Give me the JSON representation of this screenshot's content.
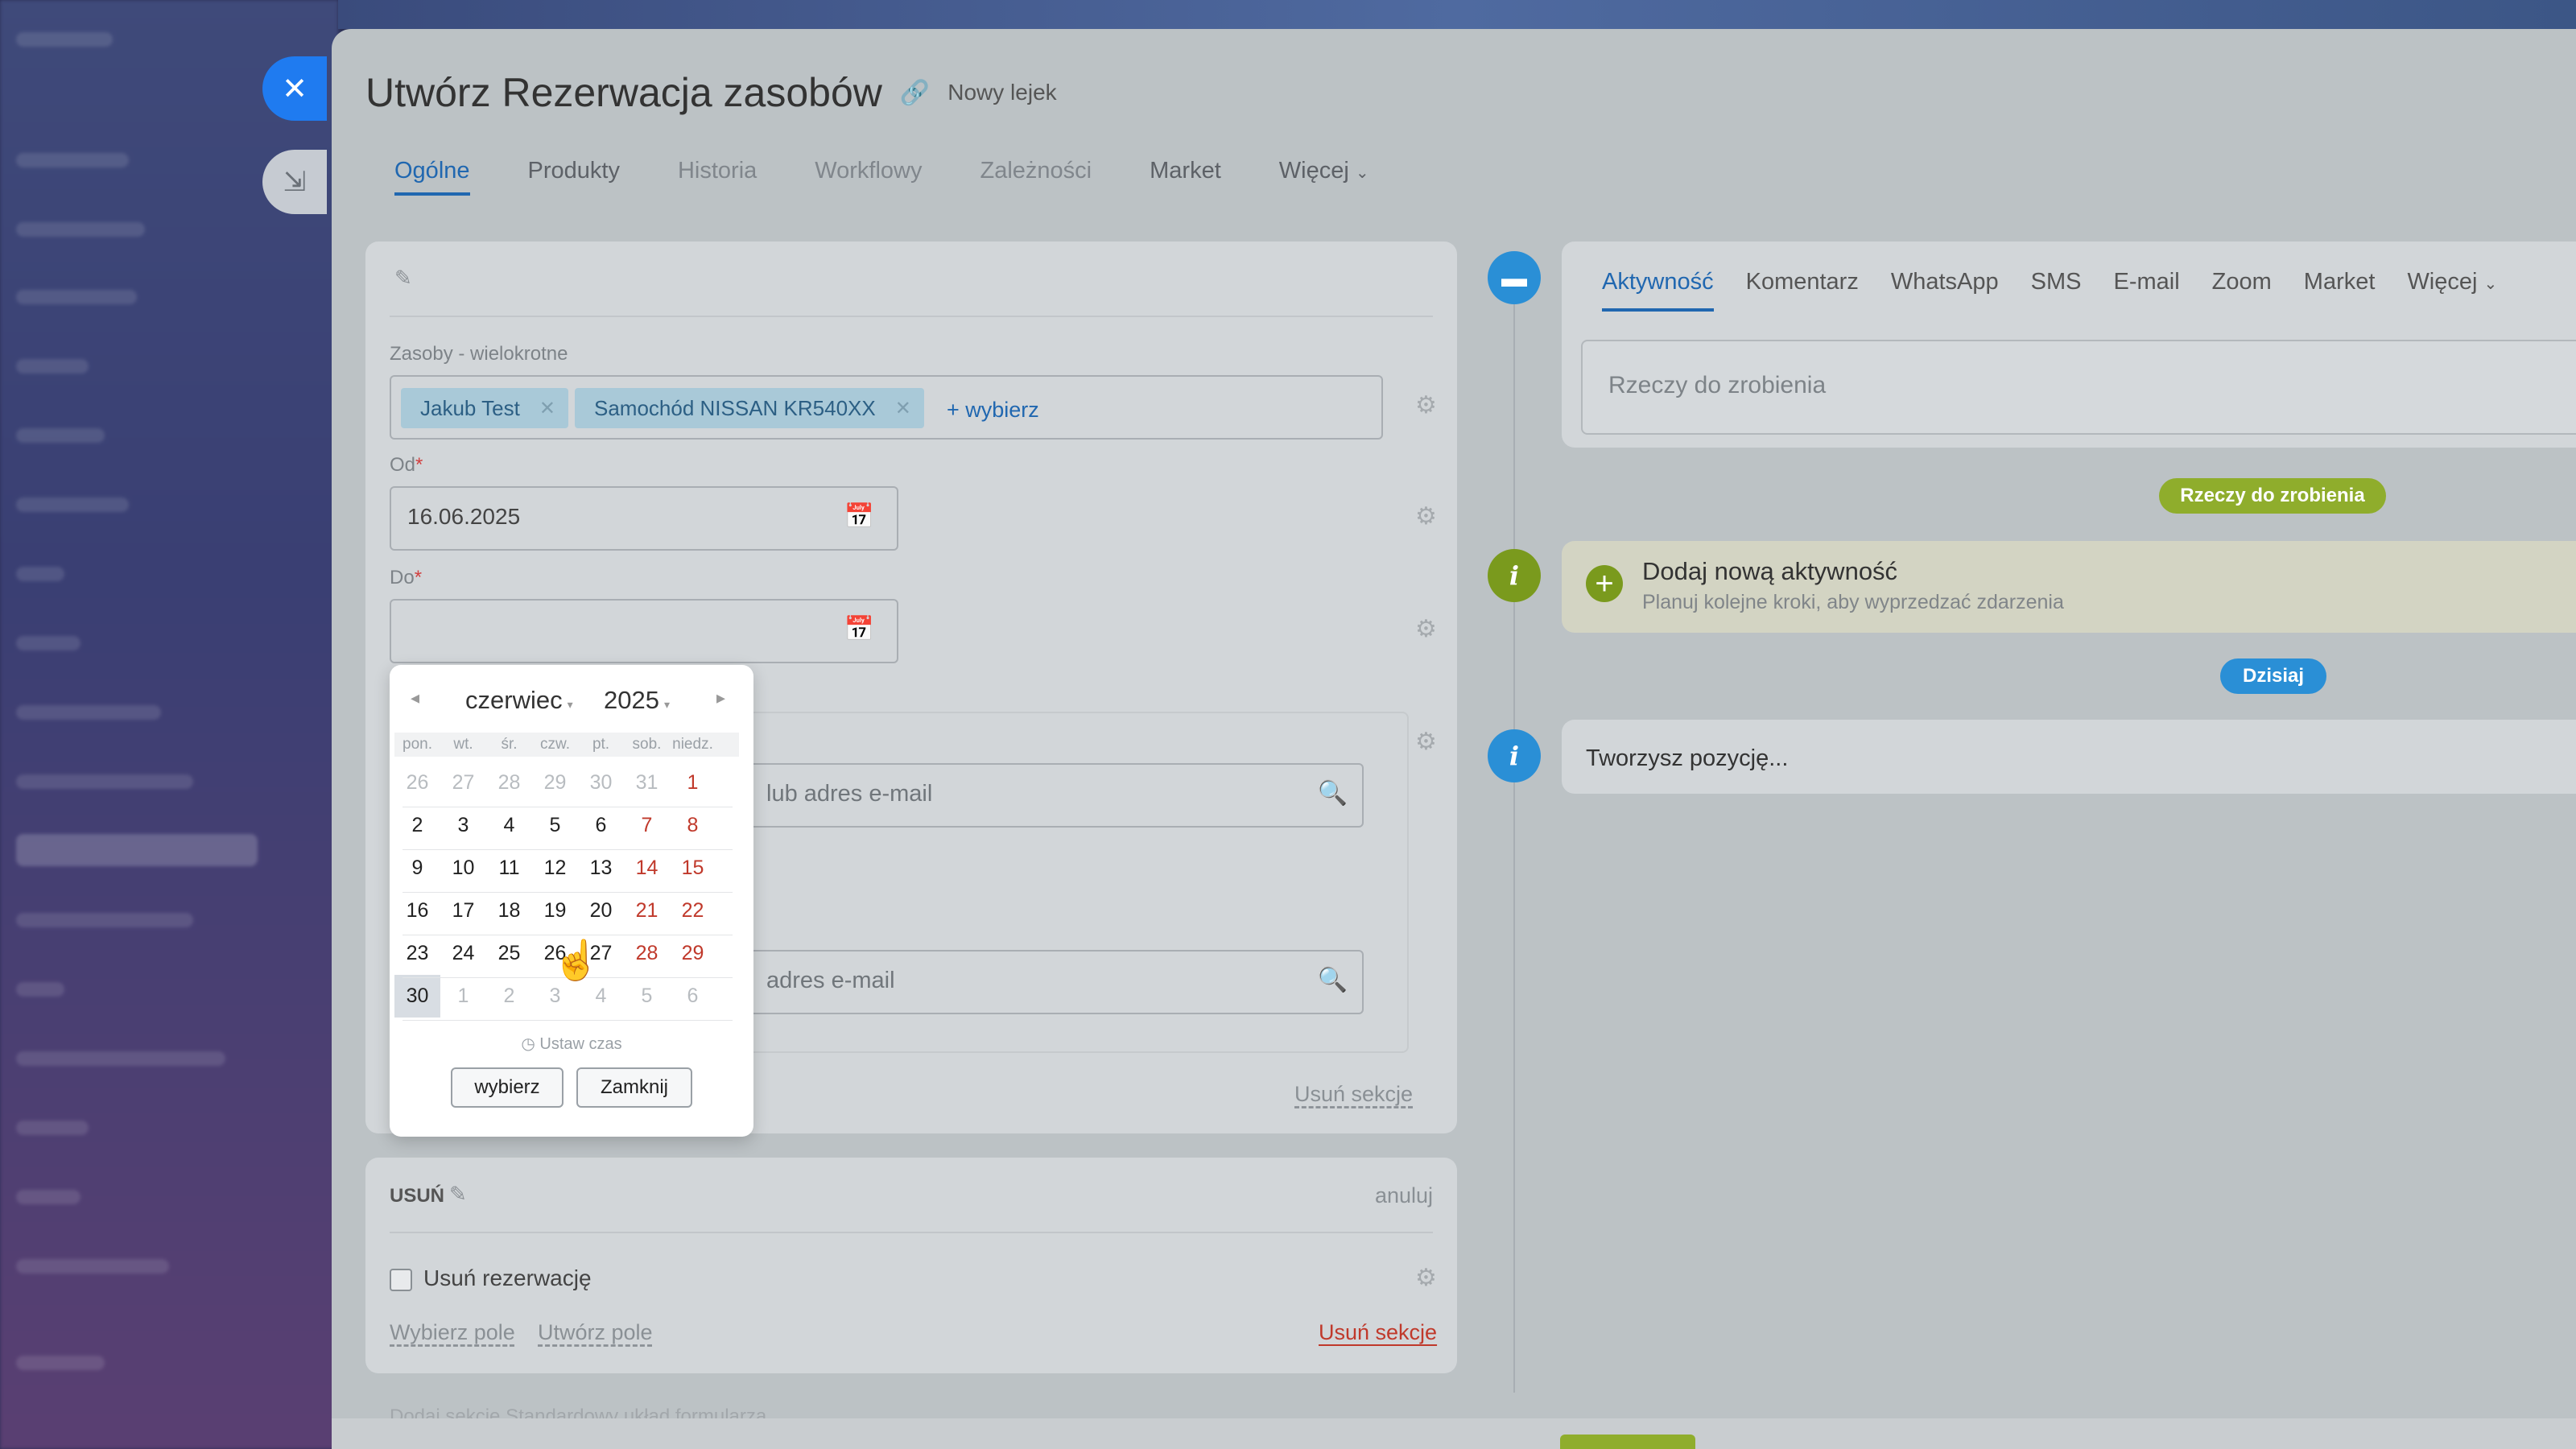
{
  "header": {
    "title": "Utwórz Rezerwacja zasobów",
    "funnel": "Nowy lejek"
  },
  "tabs": [
    "Ogólne",
    "Produkty",
    "Historia",
    "Workflowy",
    "Zależności",
    "Market",
    "Więcej"
  ],
  "form": {
    "resources_label": "Zasoby - wielokrotne",
    "chips": [
      "Jakub Test",
      "Samochód NISSAN KR540XX"
    ],
    "add_link": "+ wybierz",
    "from_label": "Od",
    "from_value": "16.06.2025",
    "to_label": "Do",
    "required_mark": "*",
    "search1_placeholder": "lub adres e-mail",
    "search2_placeholder": "adres e-mail",
    "remove_section": "Usuń sekcje"
  },
  "calendar": {
    "month": "czerwiec",
    "year": "2025",
    "weekdays": [
      "pon.",
      "wt.",
      "śr.",
      "czw.",
      "pt.",
      "sob.",
      "niedz."
    ],
    "weeks": [
      [
        "26",
        "27",
        "28",
        "29",
        "30",
        "31",
        "1"
      ],
      [
        "2",
        "3",
        "4",
        "5",
        "6",
        "7",
        "8"
      ],
      [
        "9",
        "10",
        "11",
        "12",
        "13",
        "14",
        "15"
      ],
      [
        "16",
        "17",
        "18",
        "19",
        "20",
        "21",
        "22"
      ],
      [
        "23",
        "24",
        "25",
        "26",
        "27",
        "28",
        "29"
      ],
      [
        "30",
        "1",
        "2",
        "3",
        "4",
        "5",
        "6"
      ]
    ],
    "set_time": "Ustaw czas",
    "choose_button": "wybierz",
    "close_button": "Zamknij"
  },
  "delete_section": {
    "title": "USUŃ",
    "cancel": "anuluj",
    "checkbox_label": "Usuń rezerwację",
    "select_field": "Wybierz pole",
    "create_field": "Utwórz pole",
    "remove_section": "Usuń sekcje"
  },
  "activity": {
    "tabs": [
      "Aktywność",
      "Komentarz",
      "WhatsApp",
      "SMS",
      "E-mail",
      "Zoom",
      "Market",
      "Więcej"
    ],
    "todo_placeholder": "Rzeczy do zrobienia",
    "todo_pill": "Rzeczy do zrobienia",
    "new_title": "Dodaj nową aktywność",
    "new_subtitle": "Planuj kolejne kroki, aby wyprzedzać zdarzenia",
    "today_pill": "Dzisiaj",
    "creating_text": "Tworzysz pozycję..."
  },
  "footer": {
    "faded_text": "Dodaj sekcję     Standardowy układ formularza"
  },
  "colors": {
    "accent": "#2067b0",
    "close_button": "#1f7bf0",
    "green": "#8fad2c",
    "today": "#2a8fd6",
    "weekend": "#c0392b"
  }
}
